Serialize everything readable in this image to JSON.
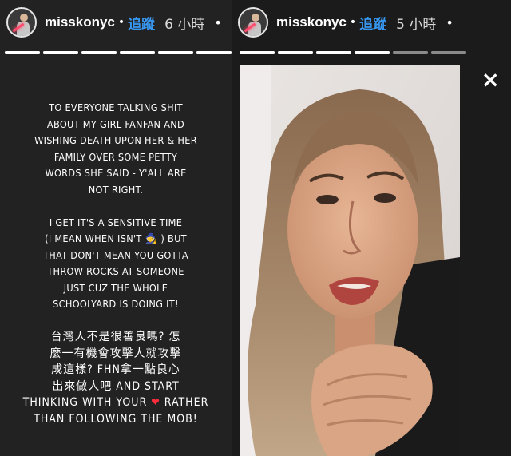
{
  "stories": [
    {
      "header": {
        "username": "misskonyc",
        "separator": "•",
        "follow": "追蹤",
        "time": "6 小時",
        "more": "•"
      },
      "progress": [
        true,
        true,
        true,
        true,
        true,
        true
      ],
      "text": {
        "para1": [
          "TO EVERYONE TALKING SHIT",
          "ABOUT MY GIRL FANFAN AND",
          "WISHING DEATH UPON HER & HER",
          "FAMILY OVER SOME PETTY",
          "WORDS SHE SAID - Y'ALL ARE",
          "NOT RIGHT."
        ],
        "para2_line1": "I GET IT'S A SENSITIVE TIME",
        "para2_line2_a": "(I MEAN WHEN ISN'T ",
        "para2_line2_emoji": "🧙",
        "para2_line2_b": " ) BUT",
        "para2_rest": [
          "THAT DON'T MEAN YOU GOTTA",
          "THROW ROCKS AT SOMEONE",
          "JUST CUZ THE WHOLE",
          "SCHOOLYARD IS DOING IT!"
        ],
        "zh_line1": "台灣人不是很善良嗎? 怎",
        "zh_line2": "麼一有機會攻擊人就攻擊",
        "zh_line3": "成這樣? FHN拿一點良心",
        "zh_line4": "出來做人吧 AND START",
        "zh_line5_a": "THINKING WITH YOUR ",
        "zh_line5_heart": "❤",
        "zh_line5_b": " RATHER",
        "zh_line6": "THAN FOLLOWING THE MOB!"
      }
    },
    {
      "header": {
        "username": "misskonyc",
        "separator": "•",
        "follow": "追蹤",
        "time": "5 小時",
        "more": "•"
      },
      "progress": [
        true,
        true,
        true,
        true,
        false,
        false
      ],
      "close_icon": "×"
    }
  ],
  "colors": {
    "follow": "#3897f0",
    "left_bg": "#222222",
    "heart": "#ff2d3b"
  }
}
